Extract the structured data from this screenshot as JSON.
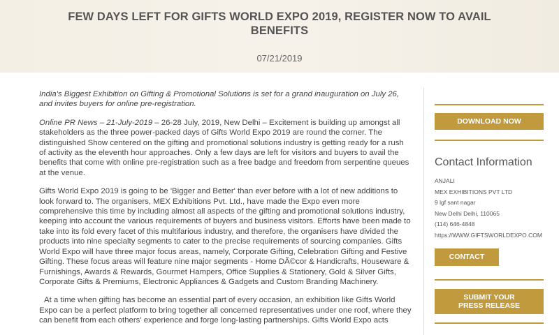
{
  "header": {
    "title": "FEW DAYS LEFT FOR GIFTS WORLD EXPO 2019, REGISTER NOW TO AVAIL BENEFITS",
    "date": "07/21/2019"
  },
  "article": {
    "lead": "India's Biggest Exhibition on Gifting & Promotional Solutions is set for a grand inauguration on July 26, and invites buyers for online pre-registration.",
    "p1_dateline": "Online PR News – 21-July-2019 –",
    "p1_text": " 26-28 July, 2019, New Delhi – Excitement is building up amongst all stakeholders as the three power-packed days of Gifts World Expo 2019 are round the corner. The distinguished Show centered on the gifting and promotional solutions industry is getting ready for a rush of activity as the eleventh hour approaches. Only a few days are left for visitors and buyers to avail the benefits that come with online pre-registration such as a free badge and freedom from serpentine queues at the venue.",
    "p2": "Gifts World Expo 2019 is going to be 'Bigger and Better' than ever before with a lot of new additions to look forward to. The organisers, MEX Exhibitions Pvt. Ltd., have made the Expo even more comprehensive this time by including almost all aspects of the gifting and promotional solutions industry, keeping into account the various requirements of buyers and business visitors. Efforts have been made to take into its fold every facet of this multifarious industry, and therefore, the organisers have divided the products into nine specialty segments to cater to the precise requirements of sourcing companies. Gifts World Expo will have three major focus areas, namely, Corporate Gifting, Celebration Gifting and Festive Gifting. These focus areas will feature nine major segments - Home DÃ©cor & Handicrafts, Houseware & Furnishings, Awards & Rewards, Gourmet Hampers, Office Supplies & Stationery, Gold & Silver Gifts, Corporate Gifts & Premiums, Electronic Appliances & Gadgets and Custom Branding Machinery.",
    "p3": "At a time when gifting has become an essential part of every occasion, an exhibition like Gifts World Expo can be a perfect platform to bring together all concerned representatives under one roof, where they can benefit from each others' experience and forge long-lasting partnerships. Gifts World Expo acts"
  },
  "sidebar": {
    "download_label": "DOWNLOAD NOW",
    "contact_title": "Contact Information",
    "contact_lines": [
      "ANJALI",
      "MEX EXHIBITIONS PVT LTD",
      "9 lgf sant nagar",
      "New Delhi Delhi, 110065",
      "(114) 646-4848",
      "https://WWW.GIFTSWORLDEXPO.COM"
    ],
    "contact_button": "CONTACT",
    "submit_line1": "SUBMIT YOUR",
    "submit_line2": "PRESS RELEASE",
    "accent_color": "#c29a3e"
  }
}
